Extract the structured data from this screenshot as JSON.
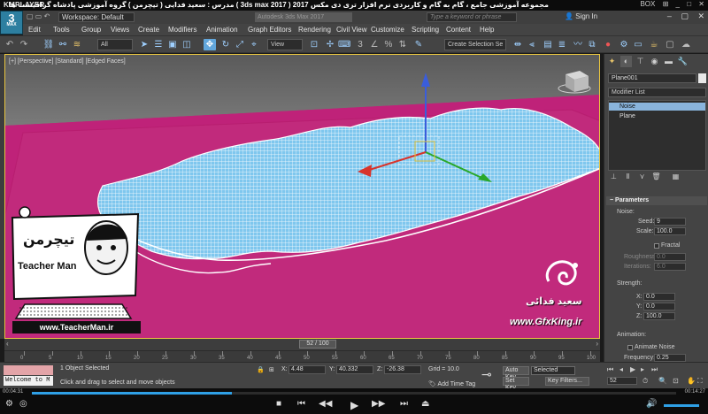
{
  "player": {
    "logo": "KMPLAYER",
    "title": "مجموعه آموزشی جامع ، گام به گام و کاربردی نرم افزار تری دی مکس 2017 ( 3ds max 2017 ) مدرس : سعید فدایی ( تیچرمن ) گروه آموزشی پادشاه گرافیست ها",
    "top_right": [
      "BOX",
      "⊞",
      "_",
      "□",
      "✕"
    ],
    "time_current": "00:04:31",
    "time_total": "00:14:27",
    "progress_fraction": 0.31
  },
  "max": {
    "logo": "3",
    "logo_sub": "MAX",
    "workspace": "Workspace: Default",
    "app_title": "Autodesk 3ds Max 2017",
    "search_placeholder": "Type a keyword or phrase",
    "sign_in": "Sign In"
  },
  "menu": [
    "Edit",
    "Tools",
    "Group",
    "Views",
    "Create",
    "Modifiers",
    "Animation",
    "Graph Editors",
    "Rendering",
    "Civil View",
    "Customize",
    "Scripting",
    "Content",
    "Help"
  ],
  "toolbar": {
    "filter": "All",
    "ref_coord": "View",
    "selection_set": "Create Selection Se"
  },
  "viewport": {
    "label": "[+] [Perspective] [Standard] [Edged Faces]"
  },
  "command_panel": {
    "object_name": "Plane001",
    "modifier_list": "Modifier List",
    "stack": [
      "Noise",
      "Plane"
    ],
    "params_title": "Parameters",
    "noise_label": "Noise:",
    "seed_label": "Seed:",
    "seed": "9",
    "scale_label": "Scale:",
    "scale": "100.0",
    "fractal": "Fractal",
    "roughness_label": "Roughness:",
    "roughness": "0.0",
    "iterations_label": "Iterations:",
    "iterations": "6.0",
    "strength_label": "Strength:",
    "sx": "0.0",
    "sy": "0.0",
    "sz": "100.0",
    "animation_label": "Animation:",
    "animate_noise": "Animate Noise",
    "frequency_label": "Frequency:",
    "frequency": "0.25"
  },
  "timeline": {
    "frame": "52 / 100",
    "ticks": [
      "0",
      "5",
      "10",
      "15",
      "20",
      "25",
      "30",
      "35",
      "40",
      "45",
      "50",
      "55",
      "60",
      "65",
      "70",
      "75",
      "80",
      "85",
      "90",
      "95",
      "100"
    ]
  },
  "status": {
    "listener": "Welcome to M",
    "selected": "1 Object Selected",
    "prompt": "Click and drag to select and move objects",
    "x": "4.48",
    "y": "40.332",
    "z": "-26.38",
    "grid": "Grid = 10.0",
    "add_time_tag": "Add Time Tag",
    "auto_key": "Auto Key",
    "selected_dd": "Selected",
    "set_key": "Set Key",
    "key_filters": "Key Filters...",
    "frame_field": "52"
  },
  "overlays": {
    "teacher_logo_text": "Teacher Man",
    "teacher_logo_fa": "تیچرمن",
    "teacher_url": "www.TeacherMan.ir",
    "gfx_name": "سعید فدائی",
    "gfx_url": "www.GfxKing.ir"
  }
}
